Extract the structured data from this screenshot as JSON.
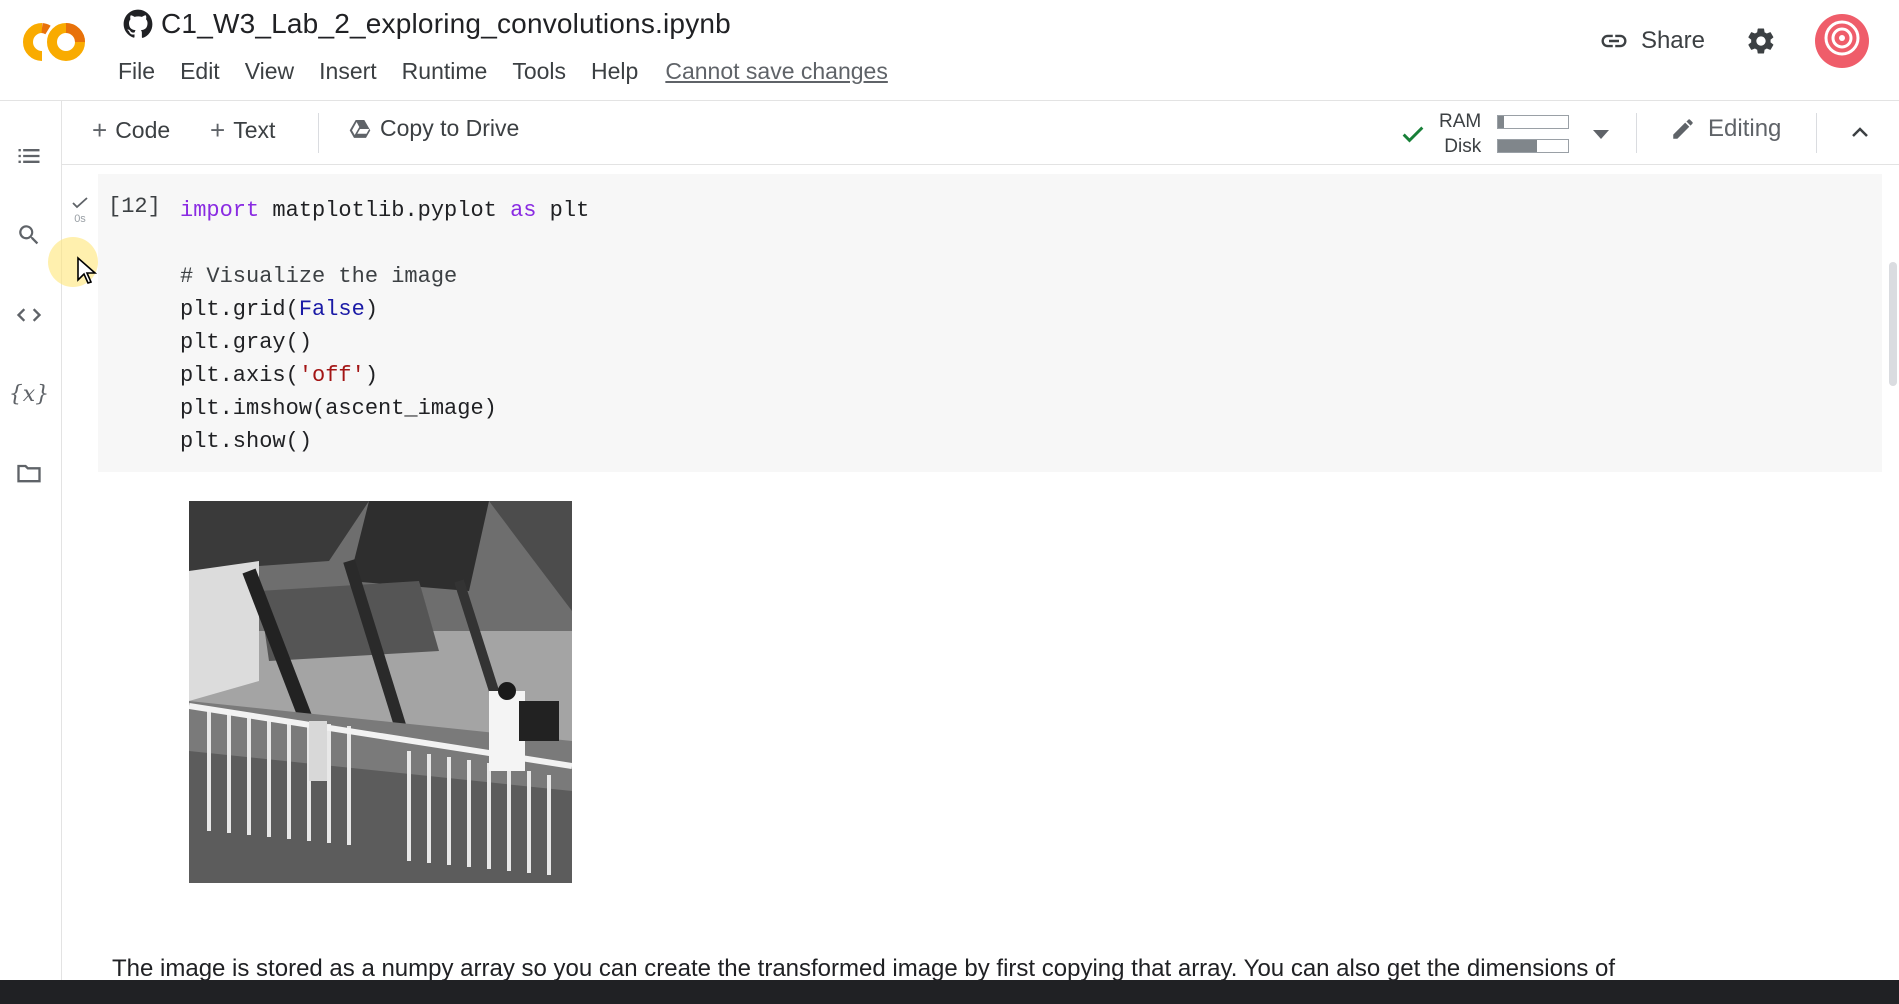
{
  "notebook": {
    "title": "C1_W3_Lab_2_exploring_convolutions.ipynb"
  },
  "menu": {
    "items": [
      "File",
      "Edit",
      "View",
      "Insert",
      "Runtime",
      "Tools",
      "Help"
    ],
    "save_status": "Cannot save changes"
  },
  "header": {
    "share_label": "Share"
  },
  "toolbar": {
    "add_code": "Code",
    "add_text": "Text",
    "copy_to_drive": "Copy to Drive",
    "ram_label": "RAM",
    "disk_label": "Disk",
    "ram_usage": 0.08,
    "disk_usage": 0.55,
    "editing_label": "Editing"
  },
  "cell": {
    "prompt": "[12]",
    "exec_time": "0s"
  },
  "text_cell": {
    "text": "The image is stored as a numpy array so you can create the transformed image by first copying that array. You can also get the dimensions of"
  },
  "colors": {
    "logo_orange": "#f9ab00",
    "logo_dark": "#e8710a",
    "avatar": "#ef5d6a",
    "check": "#188038"
  }
}
